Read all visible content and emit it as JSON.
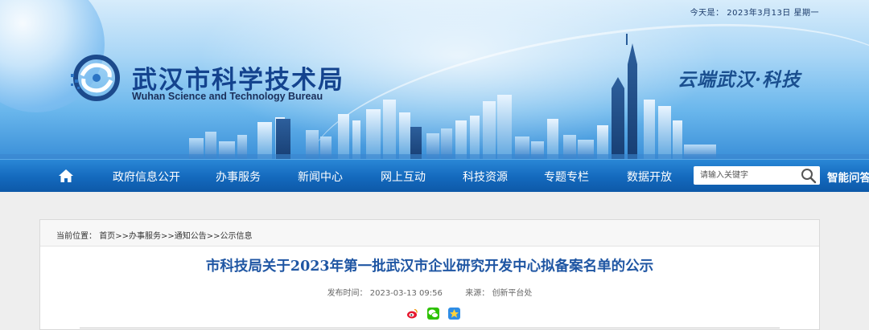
{
  "header": {
    "date_label": "今天是： 2023年3月13日 星期一",
    "site_title": "武汉市科学技术局",
    "site_subtitle": "Wuhan Science and Technology Bureau",
    "slogan": "云端武汉·科技",
    "brand_color": "#14438e",
    "icons": [
      "bureau-logo-icon"
    ]
  },
  "nav": {
    "home_icon": "home-icon",
    "items": [
      "政府信息公开",
      "办事服务",
      "新闻中心",
      "网上互动",
      "科技资源",
      "专题专栏",
      "数据开放"
    ],
    "search_placeholder": "请输入关键字",
    "search_icon": "search-icon",
    "qa_label": "智能问答",
    "bar_color": "#1469bd"
  },
  "breadcrumb": {
    "prefix": "当前位置：",
    "items": [
      "首页",
      "办事服务",
      "通知公告",
      "公示信息"
    ],
    "separator": ">>"
  },
  "article": {
    "title": "市科技局关于2023年第一批武汉市企业研究开发中心拟备案名单的公示",
    "publish_label": "发布时间：",
    "publish_time": "2023-03-13 09:56",
    "source_label": "来源：",
    "source": "创新平台处",
    "title_color": "#1f56a3",
    "share_icons": [
      "weibo-share-icon",
      "wechat-share-icon",
      "qzone-share-icon"
    ]
  }
}
